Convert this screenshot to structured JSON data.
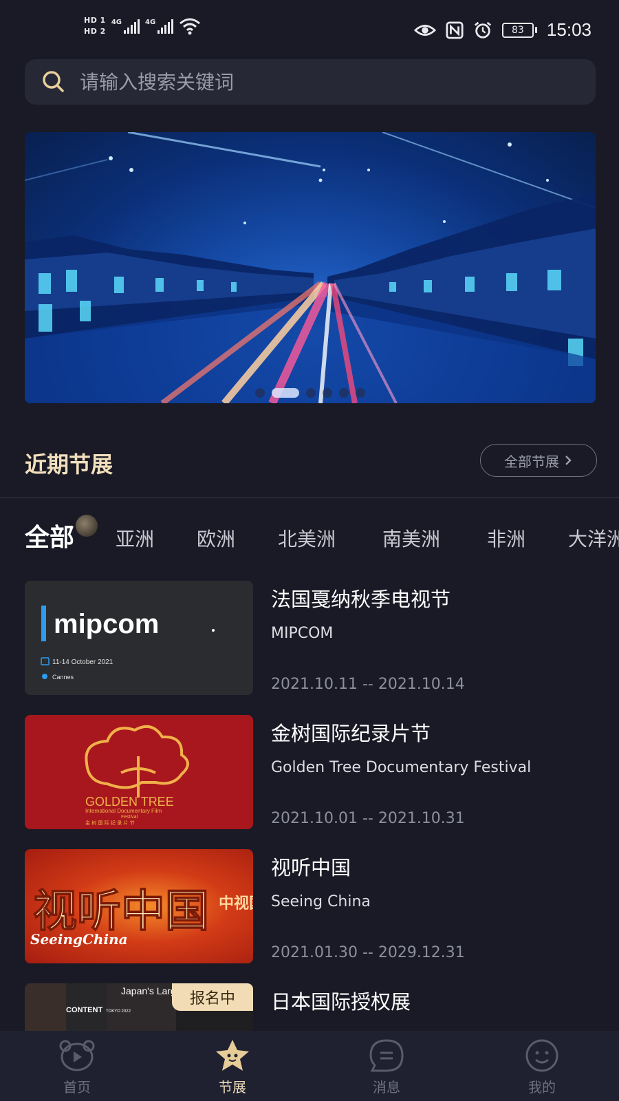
{
  "status_bar": {
    "hd1": "HD 1",
    "hd2": "HD 2",
    "net1": "4G",
    "net2": "4G",
    "battery": "83",
    "time": "15:03"
  },
  "search": {
    "placeholder": "请输入搜索关键词"
  },
  "banner": {
    "slide_count": 6,
    "active_index": 1
  },
  "section": {
    "title": "近期节展",
    "all_button": "全部节展"
  },
  "tabs": [
    "全部",
    "亚洲",
    "欧洲",
    "北美洲",
    "南美洲",
    "非洲",
    "大洋洲"
  ],
  "events": [
    {
      "title": "法国戛纳秋季电视节",
      "subtitle": "MIPCOM",
      "dates": "2021.10.11 -- 2021.10.14",
      "thumb": {
        "logo": "mipcom",
        "date_text": "11-14 October 2021",
        "place": "Cannes"
      }
    },
    {
      "title": "金树国际纪录片节",
      "subtitle": "Golden Tree Documentary Festival",
      "dates": "2021.10.01 -- 2021.10.31",
      "thumb": {
        "logo": "GOLDEN TREE",
        "line2": "International Documentary Film",
        "line3": "Festival",
        "line4": "金 树 国 际 纪 录 片 节"
      }
    },
    {
      "title": "视听中国",
      "subtitle": "Seeing China",
      "dates": "2021.01.30 -- 2029.12.31",
      "thumb": {
        "big": "视听中国",
        "small": "SeeingChina",
        "side": "中视国际"
      }
    },
    {
      "title": "日本国际授权展",
      "subtitle": "",
      "dates": "",
      "badge": "报名中",
      "thumb": {
        "top": "Japan's Largest",
        "mid": "CONTENT",
        "tag": "TOKYO 2022"
      }
    }
  ],
  "bottom_nav": [
    {
      "label": "首页",
      "icon": "bear-play-icon",
      "active": false
    },
    {
      "label": "节展",
      "icon": "star-mascot-icon",
      "active": true
    },
    {
      "label": "消息",
      "icon": "message-icon",
      "active": false
    },
    {
      "label": "我的",
      "icon": "smile-profile-icon",
      "active": false
    }
  ],
  "colors": {
    "background": "#191a25",
    "accent_gold": "#f2dfbd",
    "badge_bg": "#f1dcb6",
    "nav_bg": "#1f2130"
  }
}
